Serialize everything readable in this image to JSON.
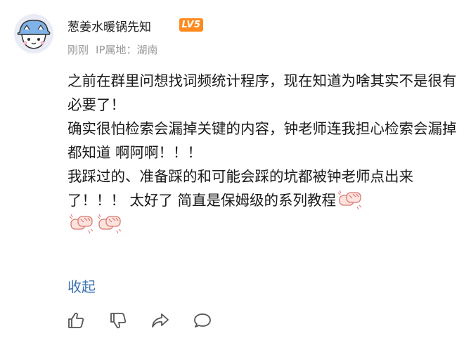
{
  "comment": {
    "author": {
      "name": "葱姜水暖锅先知",
      "level_badge": "LV5",
      "avatar_icon": "cartoon-avatar-icon"
    },
    "meta": {
      "time": "刚刚",
      "ip_location": "IP属地：湖南"
    },
    "paragraphs": [
      "之前在群里问想找词频统计程序，现在知道为啥其实不是很有必要了！",
      "确实很怕检索会漏掉关键的内容，钟老师连我担心检索会漏掉都知道 啊阿啊！！！",
      "我踩过的、准备踩的和可能会踩的坑都被钟老师点出来了！！！ 太好了 简直是保姆级的系列教程"
    ],
    "stickers": [
      "hands-clap-sticker-icon",
      "hands-clap-sticker-icon",
      "hands-clap-sticker-icon"
    ],
    "collapse_label": "收起"
  },
  "actions": [
    "thumbs-up-icon",
    "thumbs-down-icon",
    "share-icon",
    "comment-icon"
  ],
  "colors": {
    "link": "#3a72b0",
    "badge": "#ff8a1f",
    "meta": "#9a9a9a",
    "icon_stroke": "#555555"
  }
}
